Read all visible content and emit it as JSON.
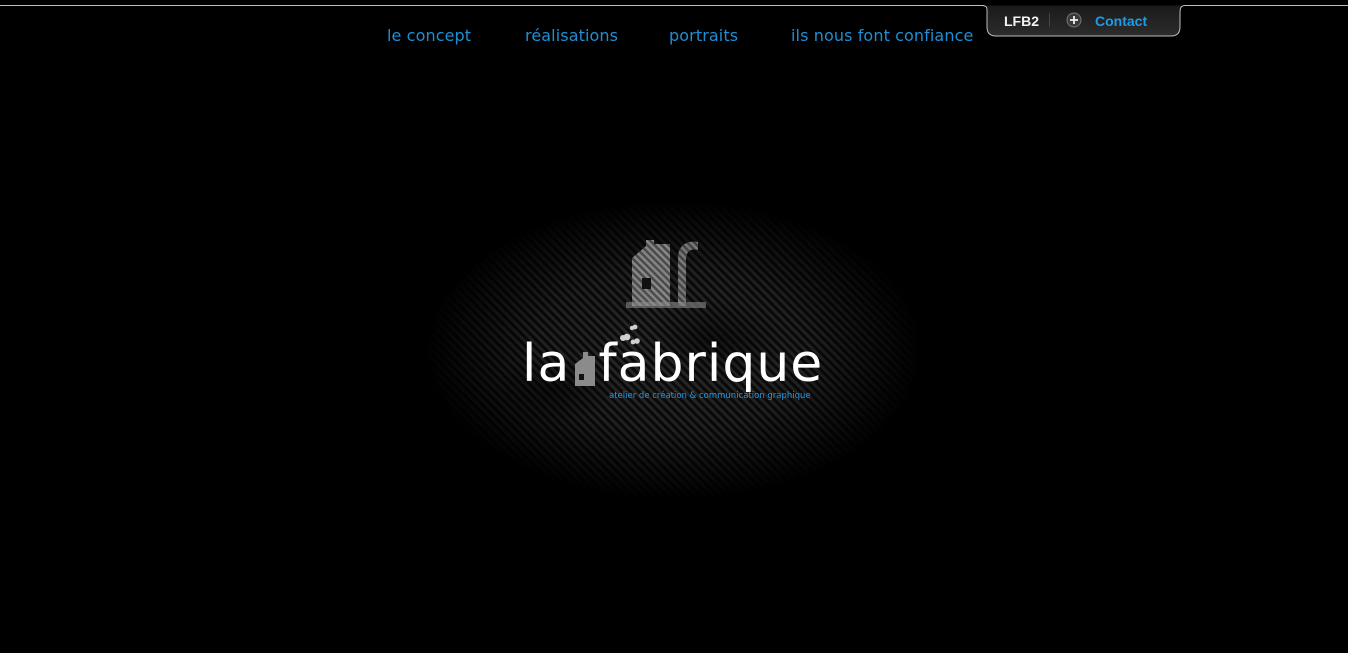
{
  "nav": {
    "items": [
      {
        "label": "le concept"
      },
      {
        "label": "réalisations"
      },
      {
        "label": "portraits"
      },
      {
        "label": "ils nous font confiance"
      }
    ]
  },
  "tab": {
    "lfb_label": "LFB2",
    "contact_label": "Contact",
    "contact_icon": "plus-circle-icon"
  },
  "logo": {
    "part1": "la",
    "part2": "fabrique",
    "tagline": "atelier de création & communication graphique",
    "icon": "factory-icon"
  },
  "colors": {
    "background": "#000000",
    "accent": "#1e8fd6",
    "text": "#ffffff"
  }
}
